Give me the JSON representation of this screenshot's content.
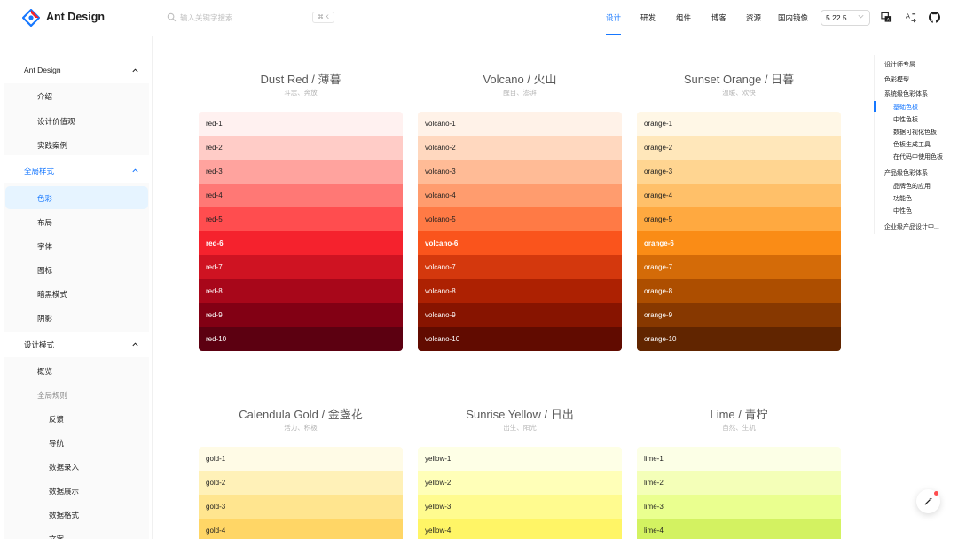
{
  "header": {
    "brand": "Ant Design",
    "search_placeholder": "输入关键字搜索...",
    "search_kbd": "⌘ K",
    "nav": [
      "设计",
      "研发",
      "组件",
      "博客",
      "资源",
      "国内镜像"
    ],
    "version": "5.22.5",
    "accent": "#1677ff"
  },
  "sidebar": {
    "groups": [
      {
        "label": "Ant Design",
        "items": [
          "介绍",
          "设计价值观",
          "实践案例"
        ]
      },
      {
        "label": "全局样式",
        "items": [
          "色彩",
          "布局",
          "字体",
          "图标",
          "暗黑模式",
          "阴影"
        ],
        "selected": "色彩"
      },
      {
        "label": "设计模式",
        "items": [
          "概览",
          "全局规则",
          "反馈",
          "导航",
          "数据录入",
          "数据展示",
          "数据格式",
          "文案"
        ]
      }
    ]
  },
  "anchor": [
    "设计师专属",
    "色彩模型",
    "系统级色彩体系",
    "基础色板",
    "中性色板",
    "数据可视化色板",
    "色板生成工具",
    "在代码中使用色板",
    "产品级色彩体系",
    "品牌色的应用",
    "功能色",
    "中性色",
    "企业级产品设计中..."
  ],
  "palettes": [
    {
      "title": "Dust Red / 薄暮",
      "subtitle": "斗志、奔放",
      "labels": [
        "red-1",
        "red-2",
        "red-3",
        "red-4",
        "red-5",
        "red-6",
        "red-7",
        "red-8",
        "red-9",
        "red-10"
      ],
      "colors": [
        "#fff1f0",
        "#ffccc7",
        "#ffa39e",
        "#ff7875",
        "#ff4d4f",
        "#f5222d",
        "#cf1322",
        "#a8071a",
        "#820014",
        "#5c0011"
      ]
    },
    {
      "title": "Volcano / 火山",
      "subtitle": "醒目、澎湃",
      "labels": [
        "volcano-1",
        "volcano-2",
        "volcano-3",
        "volcano-4",
        "volcano-5",
        "volcano-6",
        "volcano-7",
        "volcano-8",
        "volcano-9",
        "volcano-10"
      ],
      "colors": [
        "#fff2e8",
        "#ffd8bf",
        "#ffbb96",
        "#ff9c6e",
        "#ff7a45",
        "#fa541c",
        "#d4380d",
        "#ad2102",
        "#871400",
        "#610b00"
      ]
    },
    {
      "title": "Sunset Orange / 日暮",
      "subtitle": "温暖、欢快",
      "labels": [
        "orange-1",
        "orange-2",
        "orange-3",
        "orange-4",
        "orange-5",
        "orange-6",
        "orange-7",
        "orange-8",
        "orange-9",
        "orange-10"
      ],
      "colors": [
        "#fff7e6",
        "#ffe7ba",
        "#ffd591",
        "#ffc069",
        "#ffa940",
        "#fa8c16",
        "#d46b08",
        "#ad4e00",
        "#873800",
        "#612500"
      ]
    },
    {
      "title": "Calendula Gold / 金盏花",
      "subtitle": "活力、积极",
      "labels": [
        "gold-1",
        "gold-2",
        "gold-3",
        "gold-4"
      ],
      "colors": [
        "#fffbe6",
        "#fff1b8",
        "#ffe58f",
        "#ffd666"
      ]
    },
    {
      "title": "Sunrise Yellow / 日出",
      "subtitle": "出生、阳光",
      "labels": [
        "yellow-1",
        "yellow-2",
        "yellow-3",
        "yellow-4"
      ],
      "colors": [
        "#feffe6",
        "#ffffb8",
        "#fffb8f",
        "#fff566"
      ]
    },
    {
      "title": "Lime / 青柠",
      "subtitle": "自然、生机",
      "labels": [
        "lime-1",
        "lime-2",
        "lime-3",
        "lime-4"
      ],
      "colors": [
        "#fcffe6",
        "#f4ffb8",
        "#eaff8f",
        "#d3f261"
      ]
    }
  ]
}
